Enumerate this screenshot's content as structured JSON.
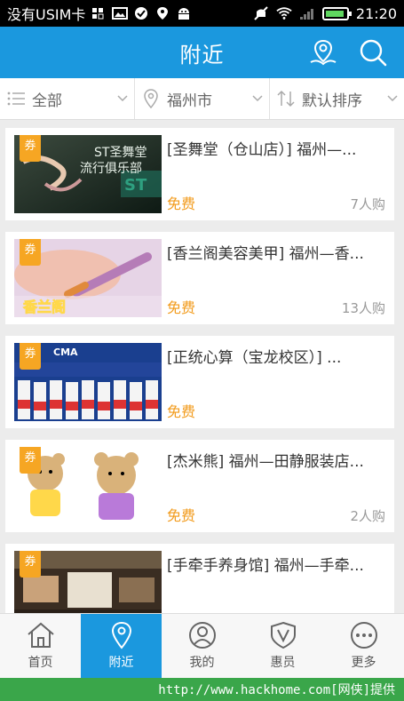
{
  "status_bar": {
    "carrier": "没有USIM卡",
    "time": "21:20",
    "icons": [
      "sim-icon",
      "image-icon",
      "check-icon",
      "location-icon",
      "android-icon",
      "mute-icon",
      "wifi-icon",
      "signal-icon",
      "battery-icon"
    ]
  },
  "header": {
    "title": "附近",
    "icons": [
      "map-pin-icon",
      "search-icon"
    ]
  },
  "filters": [
    {
      "label": "全部",
      "icon": "list-icon"
    },
    {
      "label": "福州市",
      "icon": "location-icon"
    },
    {
      "label": "默认排序",
      "icon": "sort-icon"
    }
  ],
  "items": [
    {
      "coupon": "券",
      "name": "[圣舞堂（仓山店）] 福州—...",
      "price": "免费",
      "count": "7人购",
      "thumb_text": "ST圣舞堂 流行俱乐部"
    },
    {
      "coupon": "券",
      "name": "[香兰阁美容美甲] 福州—香...",
      "price": "免费",
      "count": "13人购",
      "thumb_text": "香兰阁"
    },
    {
      "coupon": "券",
      "name": "[正统心算（宝龙校区）] ...",
      "price": "免费",
      "count": "",
      "thumb_text": "CMA"
    },
    {
      "coupon": "券",
      "name": "[杰米熊] 福州—田静服装店...",
      "price": "免费",
      "count": "2人购",
      "thumb_text": ""
    },
    {
      "coupon": "券",
      "name": "[手牵手养身馆] 福州—手牵...",
      "price": "",
      "count": "",
      "thumb_text": ""
    }
  ],
  "tabs": [
    {
      "label": "首页",
      "icon": "home-icon",
      "active": false
    },
    {
      "label": "附近",
      "icon": "location-icon",
      "active": true
    },
    {
      "label": "我的",
      "icon": "user-icon",
      "active": false
    },
    {
      "label": "惠员",
      "icon": "shield-v-icon",
      "active": false
    },
    {
      "label": "更多",
      "icon": "more-icon",
      "active": false
    }
  ],
  "watermark": "http://www.hackhome.com[网侠]提供",
  "colors": {
    "primary": "#1b98de",
    "price": "#f29b1c",
    "coupon": "#f6a623",
    "watermark_bg": "#3aa64a"
  }
}
